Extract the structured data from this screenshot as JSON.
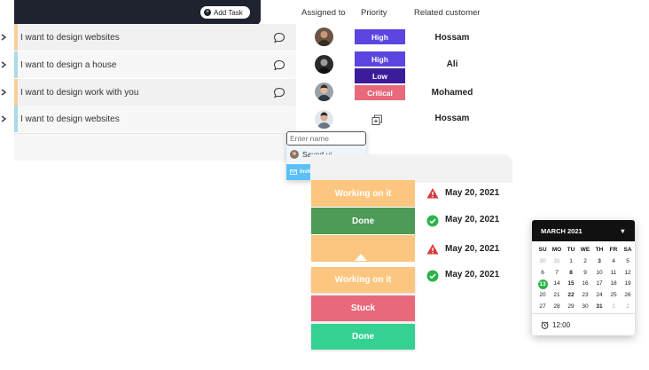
{
  "toolbar": {
    "add_task_label": "Add Task"
  },
  "columns": {
    "assigned": "Assigned to",
    "priority": "Priority",
    "customer": "Related customer"
  },
  "tasks": [
    {
      "label": "I want to design websites",
      "stripe": "#f7cf98",
      "bg": "#f1f1f1"
    },
    {
      "label": "I want to design a house",
      "stripe": "#a9dbe9",
      "bg": "#f7f7f7"
    },
    {
      "label": "I want to design work with you",
      "stripe": "#f7cf98",
      "bg": "#f1f1f1"
    },
    {
      "label": "I want to design websites",
      "stripe": "#a9dbe9",
      "bg": "#f7f7f7"
    }
  ],
  "priorities": [
    {
      "label": "High",
      "color": "#5b45e0"
    },
    {
      "label": "High",
      "color": "#5b45e0"
    },
    {
      "label": "Low",
      "color": "#3b1d9c"
    },
    {
      "label": "Critical",
      "color": "#e8697b"
    }
  ],
  "customers": [
    "Hossam",
    "Ali",
    "Mohamed",
    "Hossam"
  ],
  "assign_popup": {
    "placeholder": "Enter name",
    "suggestion": "Sayed ui",
    "invite": "Invite a new by email"
  },
  "statuses": [
    {
      "label": "Working on it",
      "color": "#fdc680"
    },
    {
      "label": "Done",
      "color": "#4e9a59"
    },
    {
      "label": "",
      "color": "#fdc680"
    }
  ],
  "status_dropdown": [
    {
      "label": "Working on it",
      "color": "#fdc680"
    },
    {
      "label": "Stuck",
      "color": "#e8697b"
    },
    {
      "label": "Done",
      "color": "#34d192"
    }
  ],
  "dates": [
    {
      "label": "May 20, 2021",
      "icon": "warning-icon"
    },
    {
      "label": "May 20, 2021",
      "icon": "check-circle-icon"
    },
    {
      "label": "May 20, 2021",
      "icon": "warning-icon"
    },
    {
      "label": "May 20, 2021",
      "icon": "check-circle-icon"
    }
  ],
  "calendar": {
    "title": "MARCH  2021",
    "weekdays": [
      "SU",
      "MO",
      "TU",
      "WE",
      "TH",
      "FR",
      "SA"
    ],
    "days": [
      "30",
      "31",
      "1",
      "2",
      "3",
      "4",
      "5",
      "6",
      "7",
      "8",
      "9",
      "10",
      "11",
      "12",
      "13",
      "14",
      "15",
      "16",
      "17",
      "18",
      "19",
      "20",
      "21",
      "22",
      "23",
      "24",
      "25",
      "26",
      "27",
      "28",
      "29",
      "30",
      "31",
      "1",
      "2"
    ],
    "muted": [
      0,
      1,
      33,
      34
    ],
    "bold": [
      4,
      9,
      16,
      23,
      32
    ],
    "selected": 14,
    "time": "12:00"
  }
}
